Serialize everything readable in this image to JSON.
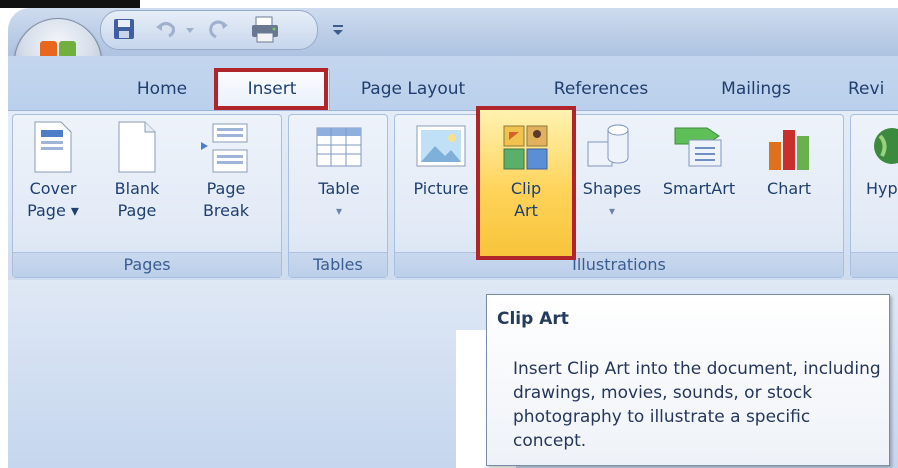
{
  "quick_access": {
    "items": [
      "save-icon",
      "undo-icon",
      "undo-dropdown-icon",
      "redo-icon",
      "quick-print-icon"
    ],
    "customize": "customize-qat-icon"
  },
  "tabs": {
    "home": "Home",
    "insert": "Insert",
    "page_layout": "Page Layout",
    "references": "References",
    "mailings": "Mailings",
    "review": "Revi"
  },
  "ribbon": {
    "pages": {
      "label": "Pages",
      "cover_page_l1": "Cover",
      "cover_page_l2": "Page ▾",
      "blank_page_l1": "Blank",
      "blank_page_l2": "Page",
      "page_break_l1": "Page",
      "page_break_l2": "Break"
    },
    "tables": {
      "label": "Tables",
      "table": "Table",
      "table_arrow": "▾"
    },
    "illustrations": {
      "label": "Illustrations",
      "picture": "Picture",
      "clip_l1": "Clip",
      "clip_l2": "Art",
      "shapes": "Shapes",
      "shapes_arrow": "▾",
      "smartart": "SmartArt",
      "chart": "Chart"
    },
    "links": {
      "hyperlink": "Hyp"
    }
  },
  "tooltip": {
    "title": "Clip Art",
    "body": "Insert Clip Art into the document, including drawings, movies, sounds, or stock photography to illustrate a specific concept."
  },
  "colors": {
    "highlight_border": "#b0242c",
    "tab_text": "#1f3f6e",
    "group_label": "#3b5e90"
  }
}
